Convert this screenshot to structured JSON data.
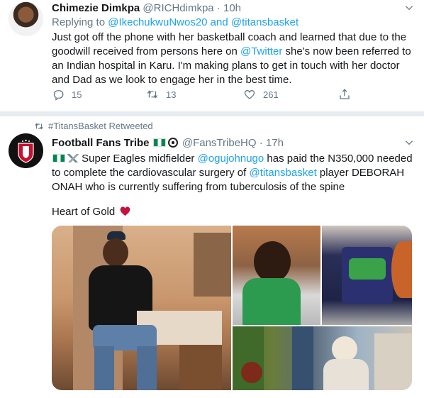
{
  "tweet1": {
    "name": "Chimezie Dimkpa",
    "handle": "@RICHdimkpa",
    "sep": "·",
    "time": "10h",
    "reply_prefix": "Replying to ",
    "reply_users": "@IkechukwuNwos20 and @titansbasket",
    "text_a": "Just got off the phone with her basketball coach and learned that due to the goodwill received from persons here on ",
    "text_link": "@Twitter",
    "text_b": " she's now been referred to an Indian hospital in Karu. I'm making plans to get in touch with her doctor and Dad as we look to engage her in the best time.",
    "replies": "15",
    "retweets": "13",
    "likes": "261"
  },
  "tweet2": {
    "retweeted_by": "#TitansBasket Retweeted",
    "name": "Football Fans Tribe",
    "handle": "@FansTribeHQ",
    "sep": "·",
    "time": "17h",
    "text_a": " Super Eagles midfielder ",
    "mention1": "@ogujohnugo",
    "text_b": " has paid the N350,000 needed to complete the cardiovascular surgery of ",
    "mention2": "@titansbasket",
    "text_c": " player DEBORAH ONAH who is currently suffering from tuberculosis of the spine",
    "text_d": "Heart of Gold"
  },
  "icons": {
    "reply": "reply-icon",
    "retweet": "retweet-icon",
    "like": "heart-icon",
    "share": "share-icon",
    "caret": "chevron-down-icon"
  },
  "colors": {
    "link": "#1da1f2",
    "muted": "#657786",
    "heart": "#c0143c"
  }
}
